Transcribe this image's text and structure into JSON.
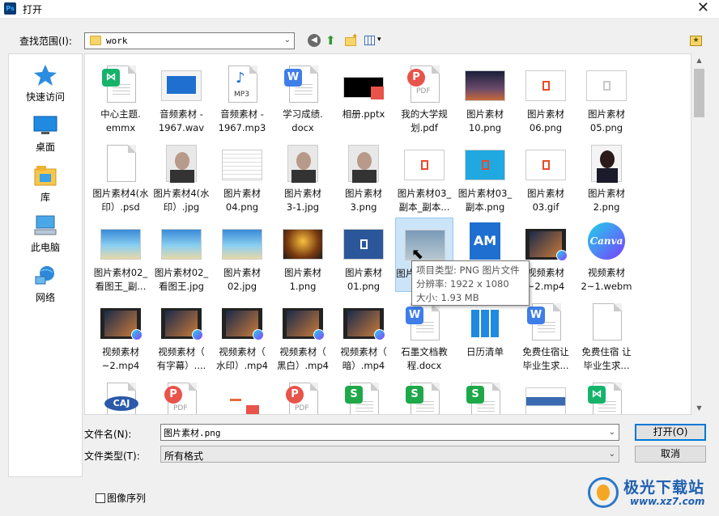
{
  "title": "打开",
  "app_icon": "Ps",
  "lookin": {
    "label": "查找范围(I):",
    "value": "work"
  },
  "places": [
    {
      "label": "快速访问",
      "icon": "star-icon"
    },
    {
      "label": "桌面",
      "icon": "desktop-icon"
    },
    {
      "label": "库",
      "icon": "library-icon"
    },
    {
      "label": "此电脑",
      "icon": "computer-icon"
    },
    {
      "label": "网络",
      "icon": "network-icon"
    }
  ],
  "files": [
    {
      "name": "中心主题.\nemmx",
      "kind": "badge",
      "badge": "⋈",
      "color": "#16b36b"
    },
    {
      "name": "音频素材 -\n1967.wav",
      "kind": "wav"
    },
    {
      "name": "音频素材 -\n1967.mp3",
      "kind": "mp3",
      "text": "MP3"
    },
    {
      "name": "学习成绩.\ndocx",
      "kind": "badge",
      "badge": "W",
      "color": "#3f7ee8"
    },
    {
      "name": "相册.pptx",
      "kind": "pptx"
    },
    {
      "name": "我的大学规\n划.pdf",
      "kind": "pdf",
      "text": "PDF",
      "badge": "P",
      "color": "#e8534a"
    },
    {
      "name": "图片素材\n10.png",
      "kind": "img",
      "bg": "linear-gradient(180deg,#1a1f3a 0%,#6a4a6a 60%,#c86a3a 100%)"
    },
    {
      "name": "图片素材\n06.png",
      "kind": "img",
      "bg": "#fff",
      "mark": "#e84a2a"
    },
    {
      "name": "图片素材\n05.png",
      "kind": "img",
      "bg": "#fff",
      "mark": "#c8c8c8"
    },
    {
      "name": "图片素材4(水\n印）.psd",
      "kind": "blank"
    },
    {
      "name": "图片素材4(水\n印）.jpg",
      "kind": "face"
    },
    {
      "name": "图片素材\n04.png",
      "kind": "img",
      "bg": "repeating-linear-gradient(180deg,#fff 0 4px,#ddd 4px 5px)"
    },
    {
      "name": "图片素材\n3-1.jpg",
      "kind": "face"
    },
    {
      "name": "图片素材\n3.png",
      "kind": "face"
    },
    {
      "name": "图片素材03_\n副本_副本...",
      "kind": "img",
      "bg": "#fff",
      "mark": "#e84a2a"
    },
    {
      "name": "图片素材03_\n副本.png",
      "kind": "img",
      "bg": "#20a8e0",
      "mark": "#e84a2a"
    },
    {
      "name": "图片素材\n03.gif",
      "kind": "img",
      "bg": "#fff",
      "mark": "#e84a2a"
    },
    {
      "name": "图片素材\n2.png",
      "kind": "portrait"
    },
    {
      "name": "图片素材02_\n看图王_副...",
      "kind": "img",
      "bg": "linear-gradient(180deg,#3a8ad8 0%,#8ad0f0 55%,#e8d8a8 100%)"
    },
    {
      "name": "图片素材02_\n看图王.jpg",
      "kind": "img",
      "bg": "linear-gradient(180deg,#3a8ad8 0%,#8ad0f0 55%,#e8d8a8 100%)"
    },
    {
      "name": "图片素材\n02.jpg",
      "kind": "img",
      "bg": "linear-gradient(180deg,#3a8ad8 0%,#8ad0f0 55%,#e8d8a8 100%)"
    },
    {
      "name": "图片素材\n1.png",
      "kind": "img",
      "bg": "radial-gradient(circle at 50% 40%,#f8c040,#7a3a10 60%,#1a1a1a)"
    },
    {
      "name": "图片素材\n01.png",
      "kind": "img",
      "bg": "#2b579a",
      "mark": "#fff"
    },
    {
      "name": "图片素材.png",
      "kind": "img",
      "bg": "linear-gradient(180deg,#7a9ab8,#b8c8d0)",
      "selected": true
    },
    {
      "name": "AM.\n...",
      "kind": "am"
    },
    {
      "name": "视频素材\n~2.mp4",
      "kind": "video"
    },
    {
      "name": "视频素材\n2~1.webm",
      "kind": "canva"
    },
    {
      "name": "视频素材\n~2.mp4",
      "kind": "video"
    },
    {
      "name": "视频素材（\n有字幕）....",
      "kind": "video"
    },
    {
      "name": "视频素材（\n水印）.mp4",
      "kind": "video"
    },
    {
      "name": "视频素材（\n黑白）.mp4",
      "kind": "video"
    },
    {
      "name": "视频素材（\n暗）.mp4",
      "kind": "video"
    },
    {
      "name": "石墨文档教\n程.docx",
      "kind": "badge",
      "badge": "W",
      "color": "#3f7ee8"
    },
    {
      "name": "日历清单",
      "kind": "calendar"
    },
    {
      "name": "免费住宿让\n毕业生求...",
      "kind": "badge",
      "badge": "W",
      "color": "#3f7ee8"
    },
    {
      "name": "免费住宿 让\n毕业生求...",
      "kind": "blank"
    },
    {
      "name": "",
      "kind": "caj",
      "text": "CAJ"
    },
    {
      "name": "",
      "kind": "pdf",
      "text": "PDF",
      "badge": "P",
      "color": "#e8534a"
    },
    {
      "name": "",
      "kind": "pptx2"
    },
    {
      "name": "",
      "kind": "pdf",
      "text": "PDF",
      "badge": "P",
      "color": "#e8534a"
    },
    {
      "name": "",
      "kind": "badge",
      "badge": "S",
      "color": "#1ea84a"
    },
    {
      "name": "",
      "kind": "badge",
      "badge": "S",
      "color": "#1ea84a"
    },
    {
      "name": "",
      "kind": "badge",
      "badge": "S",
      "color": "#1ea84a"
    },
    {
      "name": "",
      "kind": "img",
      "bg": "linear-gradient(180deg,#fff 0 30%,#3a6ab0 30% 60%,#fff 60%)"
    },
    {
      "name": "",
      "kind": "badge",
      "badge": "⋈",
      "color": "#16b36b"
    }
  ],
  "tooltip": {
    "line1": "项目类型: PNG 图片文件",
    "line2": "分辨率: 1922 x 1080",
    "line3": "大小: 1.93 MB"
  },
  "filename": {
    "label": "文件名(N):",
    "value": "图片素材.png"
  },
  "filetype": {
    "label": "文件类型(T):",
    "value": "所有格式"
  },
  "buttons": {
    "open": "打开(O)",
    "cancel": "取消"
  },
  "image_sequence": {
    "label": "图像序列",
    "checked": false
  },
  "watermark": {
    "title": "极光下载站",
    "url": "www.xz7.com"
  }
}
